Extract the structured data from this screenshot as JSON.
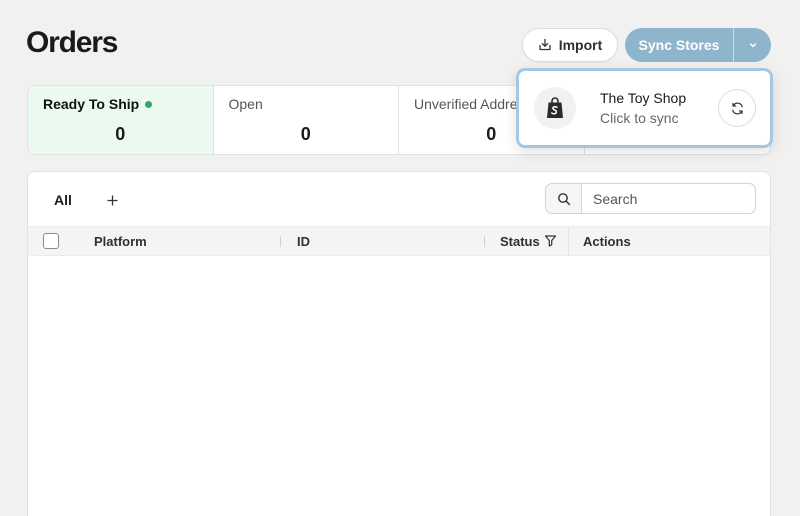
{
  "header": {
    "title": "Orders",
    "import_label": "Import",
    "sync_label": "Sync Stores"
  },
  "status_tabs": [
    {
      "label": "Ready To Ship",
      "count": "0",
      "active": true
    },
    {
      "label": "Open",
      "count": "0",
      "active": false
    },
    {
      "label": "Unverified Addresses",
      "count": "0",
      "active": false
    },
    {
      "label": "",
      "count": "",
      "active": false
    }
  ],
  "sync_popover": {
    "store_name": "The Toy Shop",
    "subtitle": "Click to sync",
    "platform_icon": "shopify-bag-icon"
  },
  "table": {
    "view_tab": "All",
    "search_placeholder": "Search",
    "columns": [
      "Platform",
      "ID",
      "Status",
      "Actions"
    ]
  },
  "colors": {
    "sync_button": "#8fb5cc",
    "active_tab_bg": "#eafaf1",
    "status_dot": "#2fa86a",
    "popover_border": "#a4c7e6"
  }
}
